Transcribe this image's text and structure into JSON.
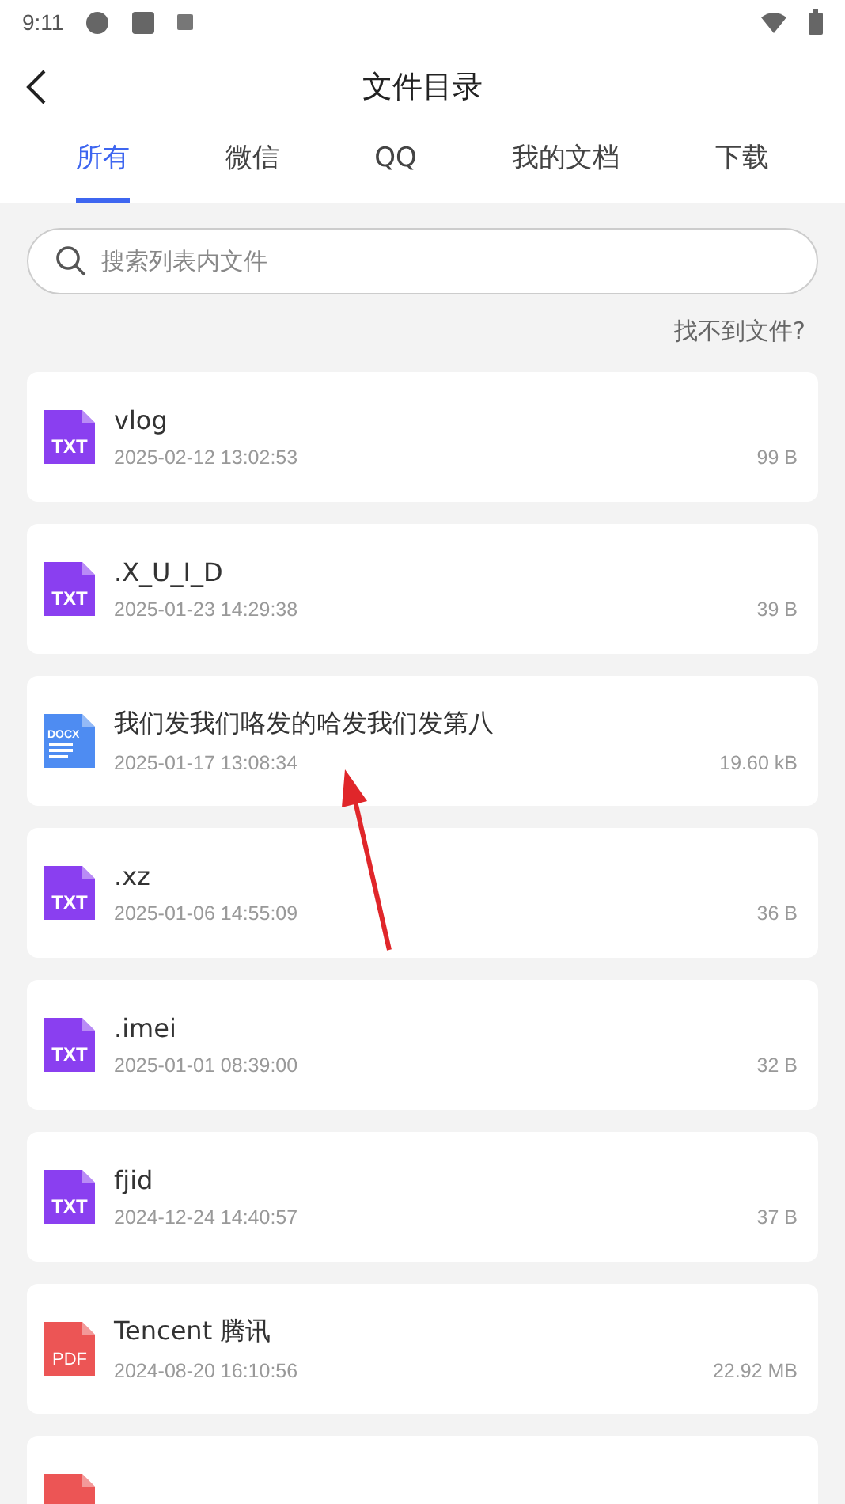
{
  "status_bar": {
    "time": "9:11"
  },
  "header": {
    "title": "文件目录"
  },
  "tabs": [
    {
      "label": "所有",
      "selected": true
    },
    {
      "label": "微信",
      "selected": false
    },
    {
      "label": "QQ",
      "selected": false
    },
    {
      "label": "我的文档",
      "selected": false
    },
    {
      "label": "下载",
      "selected": false
    }
  ],
  "search": {
    "placeholder": "搜索列表内文件"
  },
  "help_link": "找不到文件?",
  "files": [
    {
      "kind": "txt",
      "badge": "TXT",
      "name": "vlog",
      "date": "2025-02-12 13:02:53",
      "size": "99 B"
    },
    {
      "kind": "txt",
      "badge": "TXT",
      "name": ".X_U_I_D",
      "date": "2025-01-23 14:29:38",
      "size": "39 B"
    },
    {
      "kind": "docx",
      "badge": "DOCX",
      "name": "我们发我们咯发的哈发我们发第八",
      "date": "2025-01-17 13:08:34",
      "size": "19.60 kB"
    },
    {
      "kind": "txt",
      "badge": "TXT",
      "name": ".xz",
      "date": "2025-01-06 14:55:09",
      "size": "36 B"
    },
    {
      "kind": "txt",
      "badge": "TXT",
      "name": ".imei",
      "date": "2025-01-01 08:39:00",
      "size": "32 B"
    },
    {
      "kind": "txt",
      "badge": "TXT",
      "name": "fjid",
      "date": "2024-12-24 14:40:57",
      "size": "37 B"
    },
    {
      "kind": "pdf",
      "badge": "PDF",
      "name": "Tencent 腾讯",
      "date": "2024-08-20 16:10:56",
      "size": "22.92 MB"
    },
    {
      "kind": "pdf"
    }
  ]
}
